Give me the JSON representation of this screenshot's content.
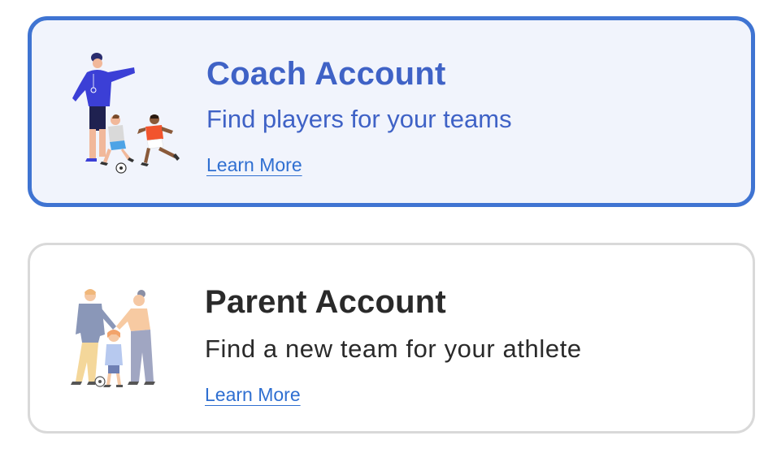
{
  "cards": [
    {
      "title": "Coach Account",
      "subtitle": "Find players for your teams",
      "link_label": "Learn More",
      "illustration": "coach-with-players-illustration",
      "selected": true,
      "accent_color": "#3f74d2"
    },
    {
      "title": "Parent Account",
      "subtitle": "Find a new team for your athlete",
      "link_label": "Learn More",
      "illustration": "family-with-child-illustration",
      "selected": false,
      "accent_color": "#d9d9d9"
    }
  ]
}
